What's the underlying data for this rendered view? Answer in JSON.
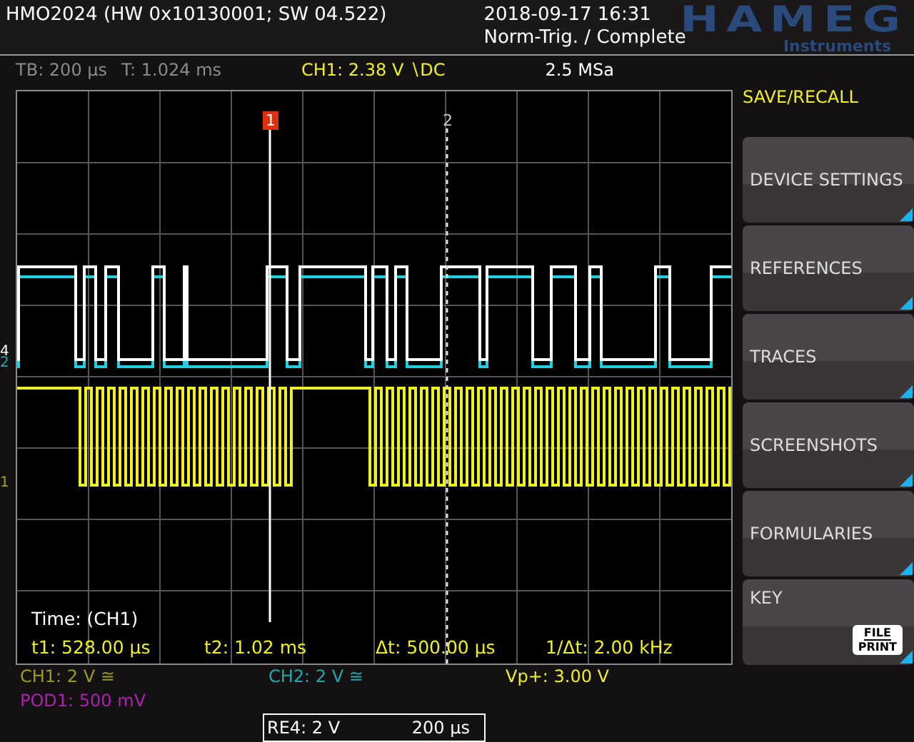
{
  "header": {
    "title": "HMO2024 (HW 0x10130001; SW 04.522)",
    "datetime": "2018-09-17 16:31",
    "trigger_status": "Norm-Trig. / Complete",
    "logo": "HAMEG",
    "logo_sub": "Instruments"
  },
  "status": {
    "timebase": "TB: 200 µs",
    "trigger_time": "T: 1.024 ms",
    "trigger": "CH1: 2.38 V ∖DC",
    "sample_rate": "2.5 MSa"
  },
  "plot": {
    "cursors": [
      {
        "label": "1",
        "kind": "solid"
      },
      {
        "label": "2",
        "kind": "dashed"
      }
    ],
    "channel_markers": [
      {
        "label": "4",
        "color": "#ffffff"
      },
      {
        "label": "2",
        "color": "#20a8b0"
      },
      {
        "label": "1",
        "color": "#a0a020"
      }
    ],
    "measurement": {
      "title": "Time: (CH1)",
      "values": [
        "t1: 528.00 µs",
        "t2: 1.02 ms",
        "Δt: 500.00 µs",
        "1/Δt: 2.00 kHz"
      ]
    }
  },
  "menu": {
    "title": "SAVE/RECALL",
    "items": [
      {
        "label": "DEVICE SETTINGS",
        "kind": "button"
      },
      {
        "label": "REFERENCES",
        "kind": "button"
      },
      {
        "label": "TRACES",
        "kind": "button"
      },
      {
        "label": "SCREENSHOTS",
        "kind": "button"
      },
      {
        "label": "FORMULARIES",
        "kind": "button"
      },
      {
        "label": "KEY",
        "kind": "key",
        "key_top": "FILE",
        "key_bottom": "PRINT"
      }
    ]
  },
  "channels": [
    {
      "label": "CH1: 2 V ≅",
      "color": "#9a9a1e"
    },
    {
      "label": "CH2: 2 V ≅",
      "color": "#20a8b0"
    },
    {
      "label": "Vp+: 3.00 V",
      "color": "#f0f020"
    },
    {
      "label": "POD1: 500 mV",
      "color": "#b020b0"
    }
  ],
  "reference": {
    "scale": "RE4: 2 V",
    "time": "200 µs"
  }
}
